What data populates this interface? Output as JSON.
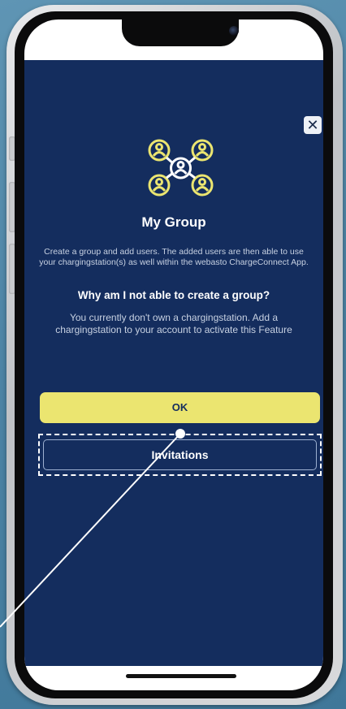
{
  "modal": {
    "close_glyph": "✕",
    "title": "My Group",
    "description": "Create a group and add users. The added users are then able to use your chargingstation(s) as well within the webasto ChargeConnect App.",
    "question": "Why am I not able to create a group?",
    "answer": "You currently don't own a chargingstation. Add a chargingstation to your account to activate this Feature",
    "ok_label": "OK",
    "invitations_label": "Invitations"
  },
  "colors": {
    "modal_bg": "#142d5e",
    "accent_yellow": "#ebe570",
    "icon_white": "#ffffff",
    "text_muted": "#c7d1e2"
  },
  "icons": [
    "close-icon",
    "group-users-icon"
  ]
}
